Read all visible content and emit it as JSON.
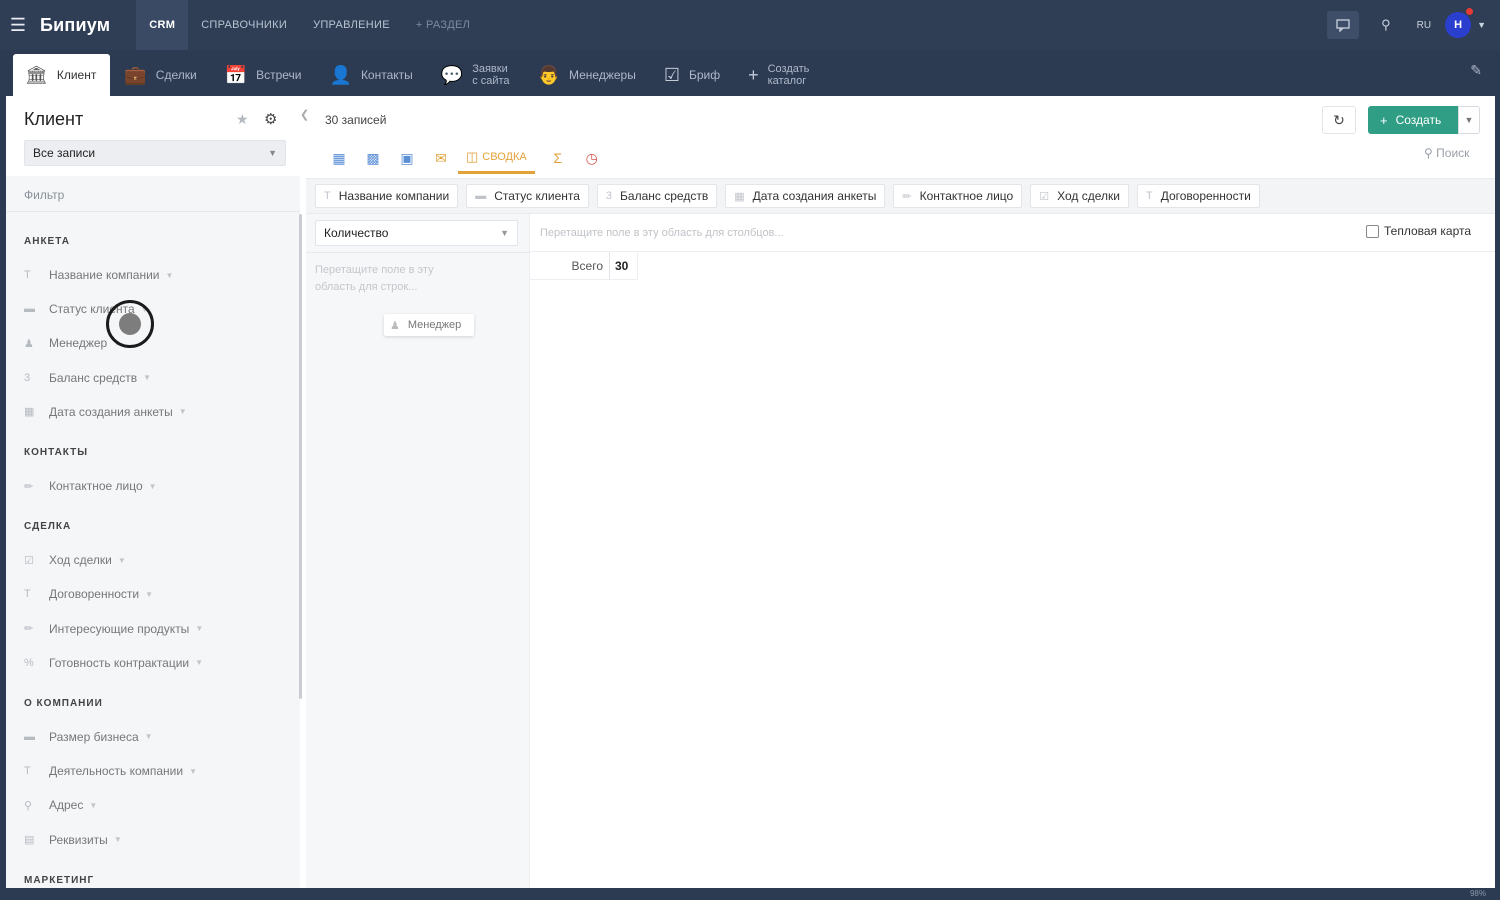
{
  "topbar": {
    "brand": "Бипиум",
    "nav": [
      "CRM",
      "Справочники",
      "Управление",
      "+ Раздел"
    ],
    "lang": "RU",
    "avatar_letter": "Н"
  },
  "tabs": [
    {
      "label": "Клиент",
      "icon": "building-icon"
    },
    {
      "label": "Сделки",
      "icon": "briefcase-icon"
    },
    {
      "label": "Встречи",
      "icon": "calendar-icon"
    },
    {
      "label": "Контакты",
      "icon": "person-icon"
    },
    {
      "label1": "Заявки",
      "label2": "с сайта",
      "icon": "chat-icon"
    },
    {
      "label": "Менеджеры",
      "icon": "manager-icon"
    },
    {
      "label": "Бриф",
      "icon": "checklist-icon"
    },
    {
      "label1": "Создать",
      "label2": "каталог",
      "icon": "plus-icon"
    }
  ],
  "left": {
    "title": "Клиент",
    "select": "Все записи",
    "filter": "Фильтр",
    "sections": [
      {
        "name": "Анкета",
        "items": [
          "Название компании",
          "Статус клиента",
          "Менеджер",
          "Баланс средств",
          "Дата создания анкеты"
        ]
      },
      {
        "name": "Контакты",
        "items": [
          "Контактное лицо"
        ]
      },
      {
        "name": "Сделка",
        "items": [
          "Ход сделки",
          "Договоренности",
          "Интересующие продукты",
          "Готовность контрактации"
        ]
      },
      {
        "name": "О компании",
        "items": [
          "Размер бизнеса",
          "Деятельность компании",
          "Адрес",
          "Реквизиты"
        ]
      },
      {
        "name": "Маркетинг",
        "items": []
      }
    ]
  },
  "main": {
    "records": "30 записей",
    "create_label": "Создать",
    "view_active": "Сводка",
    "search": "Поиск",
    "fields": [
      "Название компании",
      "Статус клиента",
      "Баланс средств",
      "Дата создания анкеты",
      "Контактное лицо",
      "Ход сделки",
      "Договоренности"
    ],
    "measure": "Количество",
    "rows_drop": "Перетащите поле в эту область для строк...",
    "drag_chip": "Менеджер",
    "cols_drop": "Перетащите поле в эту область для столбцов...",
    "heatmap": "Тепловая карта",
    "total_label": "Всего",
    "total_value": "30"
  },
  "footer": {
    "zoom": "98%"
  }
}
